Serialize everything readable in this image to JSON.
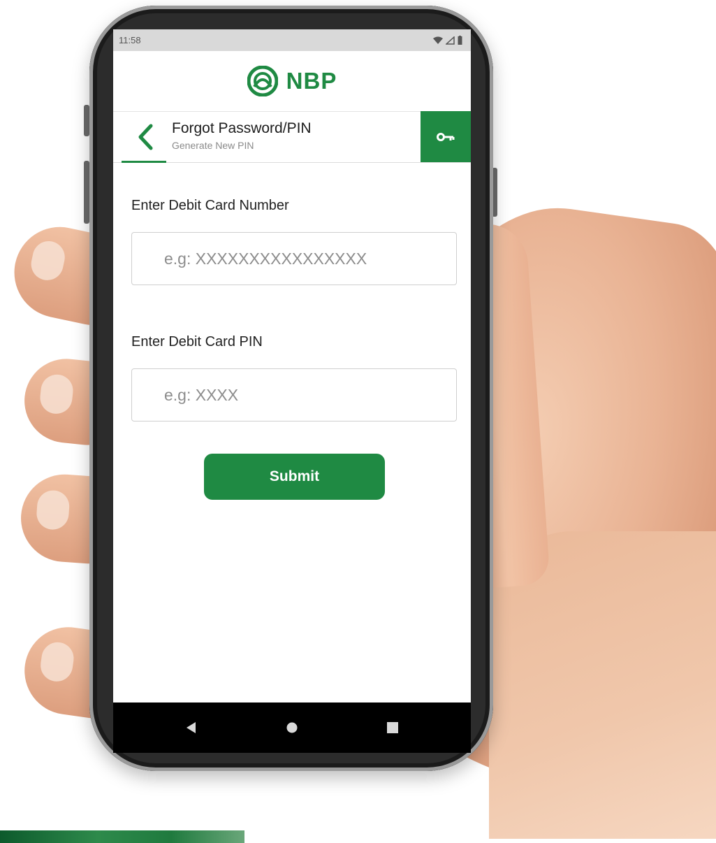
{
  "status_bar": {
    "time": "11:58",
    "icons": [
      "wifi-icon",
      "signal-icon",
      "battery-icon"
    ]
  },
  "brand": {
    "name": "NBP",
    "logo_icon": "nbp-logo-icon"
  },
  "header": {
    "title": "Forgot Password/PIN",
    "subtitle": "Generate New PIN",
    "back_icon": "chevron-left-icon",
    "action_icon": "key-icon"
  },
  "form": {
    "card_number": {
      "label": "Enter Debit Card Number",
      "placeholder": "e.g: XXXXXXXXXXXXXXXX",
      "value": ""
    },
    "card_pin": {
      "label": "Enter Debit Card PIN",
      "placeholder": "e.g: XXXX",
      "value": ""
    },
    "submit_label": "Submit"
  },
  "nav_bar": {
    "buttons": [
      "back-triangle-icon",
      "home-circle-icon",
      "recents-square-icon"
    ]
  },
  "colors": {
    "brand_green": "#1f8a43",
    "status_bar": "#d9d9d9",
    "nav_bar": "#000000"
  }
}
